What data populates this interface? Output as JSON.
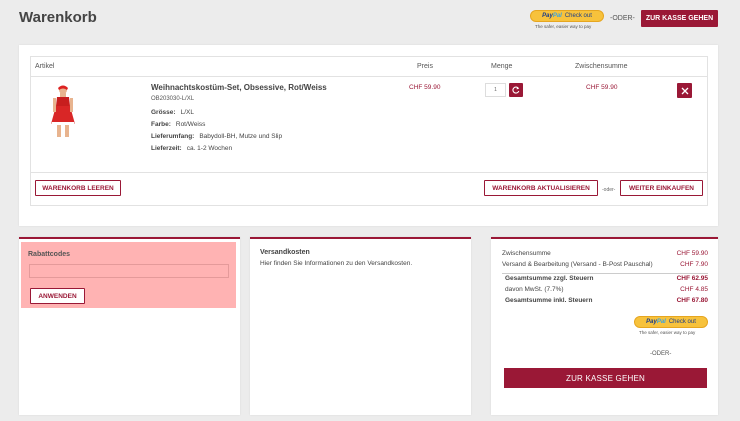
{
  "page": {
    "title": "Warenkorb"
  },
  "header": {
    "paypal_logo_pay": "Pay",
    "paypal_logo_pal": "Pal",
    "paypal_checkout": "Check out",
    "paypal_tagline": "The safer, easier way to pay",
    "or_label": "-ODER-",
    "checkout_button": "ZUR KASSE GEHEN"
  },
  "cart": {
    "columns": {
      "article": "Artikel",
      "price": "Preis",
      "quantity": "Menge",
      "subtotal": "Zwischensumme"
    },
    "items": [
      {
        "name": "Weihnachtskostüm-Set, Obsessive, Rot/Weiss",
        "sku": "OB203030-L/XL",
        "attributes": [
          {
            "key": "Grösse:",
            "value": "L/XL"
          },
          {
            "key": "Farbe:",
            "value": "Rot/Weiss"
          },
          {
            "key": "Lieferumfang:",
            "value": "Babydoll-BH, Mutze und Slip"
          },
          {
            "key": "Lieferzeit:",
            "value": "ca. 1-2 Wochen"
          }
        ],
        "price": "CHF 59.90",
        "quantity": "1",
        "subtotal": "CHF 59.90"
      }
    ],
    "empty_button": "WARENKORB LEEREN",
    "update_button": "WARENKORB AKTUALISIEREN",
    "or_label": "-oder-",
    "continue_button": "WEITER EINKAUFEN"
  },
  "coupon": {
    "title": "Rabattcodes",
    "input_value": "",
    "apply_button": "ANWENDEN"
  },
  "shipping": {
    "title": "Versandkosten",
    "text": "Hier finden Sie Informationen zu den Versandkosten."
  },
  "totals": {
    "rows": [
      {
        "label": "Zwischensumme",
        "value": "CHF 59.90"
      },
      {
        "label": "Versand & Bearbeitung (Versand - B-Post Pauschal)",
        "value": "CHF 7.90"
      },
      {
        "label": "Gesamtsumme zzgl. Steuern",
        "value": "CHF 62.95"
      },
      {
        "label": "davon MwSt. (7.7%)",
        "value": "CHF 4.85"
      },
      {
        "label": "Gesamtsumme inkl. Steuern",
        "value": "CHF 67.80"
      }
    ],
    "or_label": "-ODER-",
    "checkout_button": "ZUR KASSE GEHEN"
  },
  "colors": {
    "accent": "#9a1836",
    "coupon_bg": "#ffb3b3",
    "paypal_yellow": "#f7c23c"
  }
}
